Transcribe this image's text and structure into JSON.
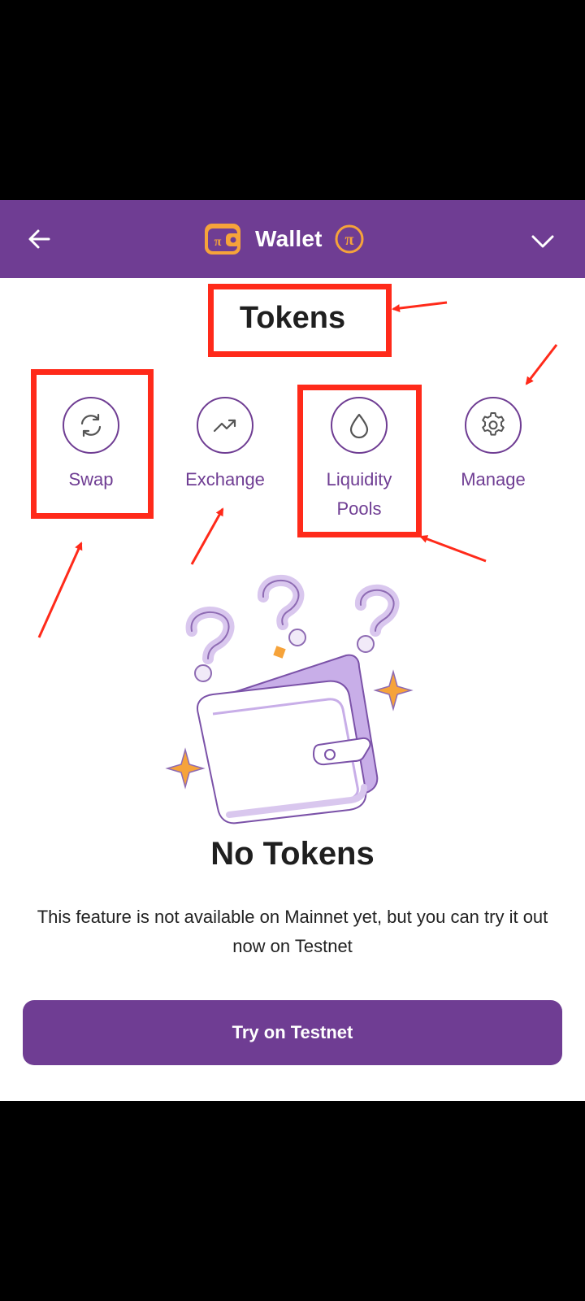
{
  "header": {
    "title": "Wallet",
    "back_icon": "arrow-left-icon",
    "wallet_icon": "pi-wallet-icon",
    "coin_icon": "pi-coin-icon",
    "chevron_icon": "chevron-down-icon"
  },
  "section_title": "Tokens",
  "actions": [
    {
      "label": "Swap",
      "icon": "swap-icon"
    },
    {
      "label": "Exchange",
      "icon": "trend-up-icon"
    },
    {
      "label_line1": "Liquidity",
      "label_line2": "Pools",
      "icon": "droplet-icon"
    },
    {
      "label": "Manage",
      "icon": "gear-icon"
    }
  ],
  "empty_state": {
    "title": "No Tokens",
    "description": "This feature is not available on Mainnet yet, but you can try it out now on Testnet",
    "cta_label": "Try on Testnet"
  },
  "colors": {
    "brand_purple": "#6f3d93",
    "accent_gold": "#f6a33a",
    "annotation_red": "#ff2a1a"
  }
}
